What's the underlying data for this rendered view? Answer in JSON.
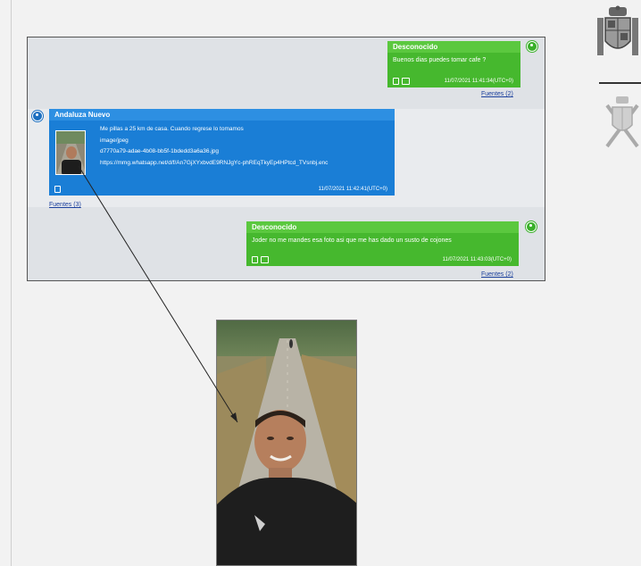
{
  "messages": [
    {
      "sender": "Desconocido",
      "text": "Buenos dias puedes tomar cafe ?",
      "timestamp": "11/07/2021 11:41:34(UTC+0)",
      "sources": "Fuentes (2)"
    },
    {
      "sender": "Andaluza Nuevo",
      "lines": [
        "Me pillas a 25 km de casa. Cuando regrese lo tomamos",
        "image/jpeg",
        "d7770a79-adae-4b08-bb5f-1bdedd3a6a36.jpg",
        "https://mmg.whatsapp.net/d/f/An7GjXYxbvdE9RNJgYc-phREqTkyEp4HPtcd_TVsnbj.enc"
      ],
      "timestamp": "11/07/2021 11:42:41(UTC+0)",
      "sources": "Fuentes (3)"
    },
    {
      "sender": "Desconocido",
      "text": "Joder no me mandes esa foto asi que me has dado un susto de cojones",
      "timestamp": "11/07/2021 11:43:03(UTC+0)",
      "sources": "Fuentes (2)"
    }
  ],
  "colors": {
    "green": "#46b82e",
    "blue": "#1a7ed6",
    "link": "#1a3f9c"
  },
  "icons": [
    "user-avatar-icon",
    "phone-icon",
    "image-icon",
    "coat-of-arms-icon",
    "guardia-civil-emblem-icon"
  ]
}
